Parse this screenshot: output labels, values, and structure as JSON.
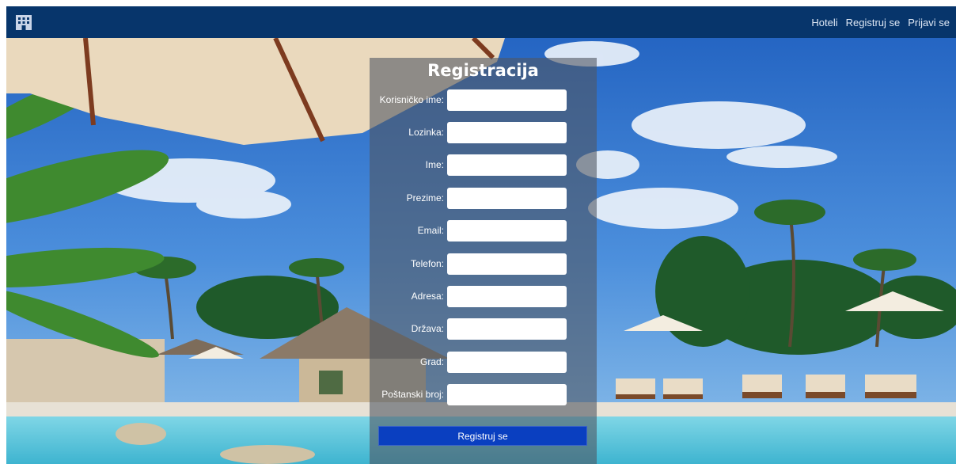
{
  "navbar": {
    "logo_icon": "hotel-building-icon",
    "links": [
      "Hoteli",
      "Registruj se",
      "Prijavi se"
    ],
    "background_color": "#07356b"
  },
  "form": {
    "title": "Registracija",
    "fields": [
      {
        "label": "Korisničko ime:",
        "value": ""
      },
      {
        "label": "Lozinka:",
        "value": ""
      },
      {
        "label": "Ime:",
        "value": ""
      },
      {
        "label": "Prezime:",
        "value": ""
      },
      {
        "label": "Email:",
        "value": ""
      },
      {
        "label": "Telefon:",
        "value": ""
      },
      {
        "label": "Adresa:",
        "value": ""
      },
      {
        "label": "Država:",
        "value": ""
      },
      {
        "label": "Grad:",
        "value": ""
      },
      {
        "label": "Poštanski broj:",
        "value": ""
      }
    ],
    "submit_label": "Registruj se",
    "submit_color": "#0a3fc0"
  },
  "background": {
    "icon": "tropical-resort-pool-photo"
  }
}
